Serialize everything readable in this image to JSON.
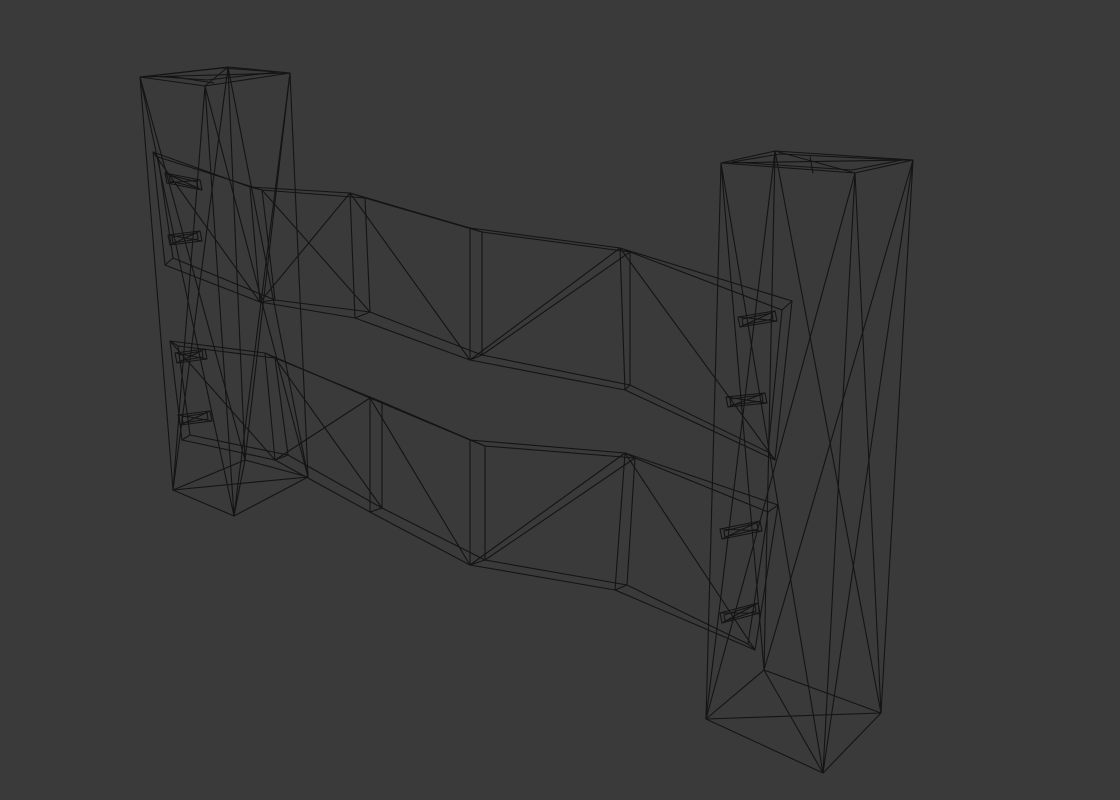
{
  "viewport": {
    "background_color": "#3a3a3a",
    "wire_color": "#141414",
    "render_mode": "wireframe",
    "model": "fence-section",
    "parts": [
      "left-post",
      "right-post",
      "upper-rail",
      "lower-rail",
      "bolts"
    ]
  }
}
